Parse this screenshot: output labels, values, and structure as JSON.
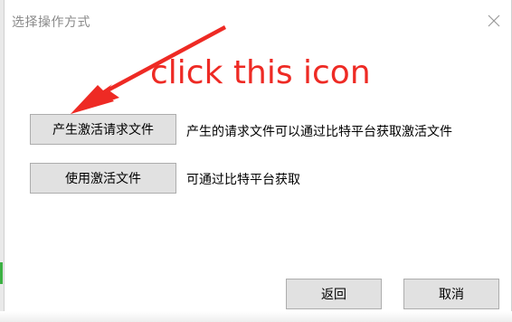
{
  "dialog": {
    "title": "选择操作方式",
    "close_icon": "close-icon"
  },
  "actions": [
    {
      "button_label": "产生激活请求文件",
      "description": "产生的请求文件可以通过比特平台获取激活文件"
    },
    {
      "button_label": "使用激活文件",
      "description": "可通过比特平台获取"
    }
  ],
  "footer": {
    "back_label": "返回",
    "cancel_label": "取消"
  },
  "annotation": {
    "text": "click this icon",
    "color": "#ee2a24"
  }
}
